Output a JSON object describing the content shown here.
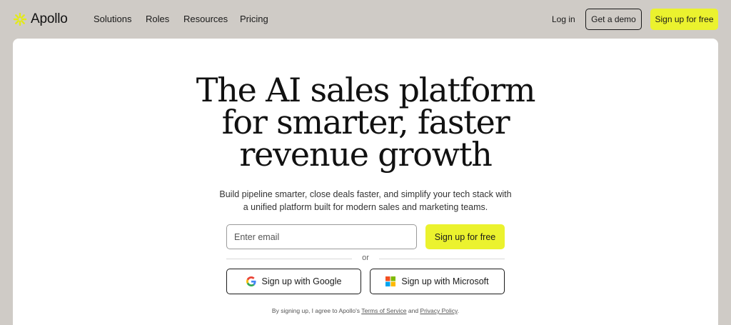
{
  "brand": {
    "name": "Apollo",
    "accent": "#ebf22e",
    "logo_icon": "sunburst-icon"
  },
  "nav": {
    "links": [
      "Solutions",
      "Roles",
      "Resources",
      "Pricing"
    ],
    "login": "Log in",
    "demo": "Get a demo",
    "signup": "Sign up for free"
  },
  "hero": {
    "headline": [
      "The AI sales platform",
      "for smarter, faster",
      "revenue growth"
    ],
    "subtext": [
      "Build pipeline smarter, close deals faster, and simplify your tech stack with",
      "a unified platform built for modern sales and marketing teams."
    ],
    "email_placeholder": "Enter email",
    "email_value": "",
    "signup_button": "Sign up for free",
    "or": "or",
    "google_button": "Sign up with Google",
    "microsoft_button": "Sign up with Microsoft",
    "legal": {
      "prefix": "By signing up, I agree to Apollo's ",
      "terms": "Terms of Service",
      "and": " and ",
      "privacy": "Privacy Policy",
      "suffix": "."
    }
  }
}
